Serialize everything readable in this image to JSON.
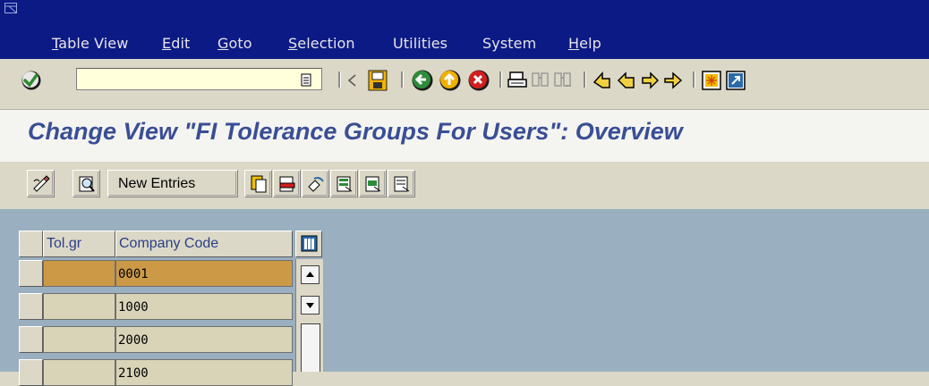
{
  "menu": {
    "items": [
      "Table View",
      "Edit",
      "Goto",
      "Selection",
      "Utilities",
      "System",
      "Help"
    ]
  },
  "toolbar": {
    "command_field": {
      "value": "",
      "placeholder": ""
    },
    "icons": [
      "enter-icon",
      "history-dropdown-icon",
      "back-arrow-icon",
      "save-icon",
      "back-icon",
      "exit-icon",
      "cancel-icon",
      "print-icon",
      "find-icon",
      "find-next-icon",
      "first-page-icon",
      "previous-page-icon",
      "next-page-icon",
      "last-page-icon",
      "create-session-icon",
      "shortcut-icon"
    ]
  },
  "screen": {
    "title": "Change View \"FI Tolerance Groups For Users\": Overview"
  },
  "app_toolbar": {
    "new_entries_label": "New Entries",
    "icons": [
      "display-change-icon",
      "details-icon",
      "copy-as-icon",
      "delete-icon",
      "undo-change-icon",
      "select-all-icon",
      "select-block-icon",
      "deselect-all-icon"
    ]
  },
  "table": {
    "columns": [
      "Tol.gr",
      "Company Code"
    ],
    "rows": [
      {
        "tol_gr": "",
        "company_code": "0001",
        "selected": true
      },
      {
        "tol_gr": "",
        "company_code": "1000",
        "selected": false
      },
      {
        "tol_gr": "",
        "company_code": "2000",
        "selected": false
      },
      {
        "tol_gr": "",
        "company_code": "2100",
        "selected": false
      }
    ]
  },
  "colors": {
    "title_bar": "#0c1a86",
    "screen_title": "#3a4e95",
    "selected_row": "#cc9a47",
    "content_background": "#9aafbf"
  }
}
